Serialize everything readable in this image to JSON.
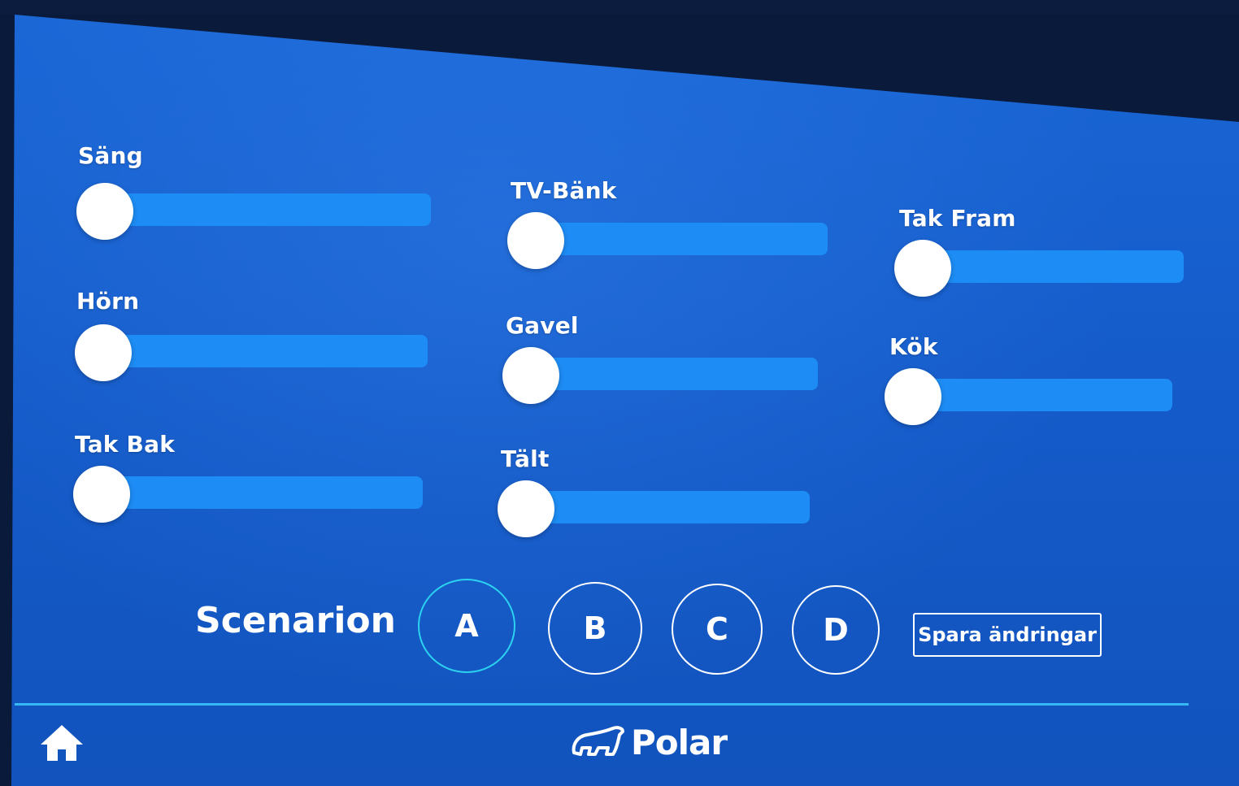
{
  "sliders": [
    {
      "label": "Säng",
      "value": 0
    },
    {
      "label": "Hörn",
      "value": 0
    },
    {
      "label": "Tak Bak",
      "value": 0
    },
    {
      "label": "TV-Bänk",
      "value": 0
    },
    {
      "label": "Gavel",
      "value": 0
    },
    {
      "label": "Tält",
      "value": 0
    },
    {
      "label": "Tak Fram",
      "value": 0
    },
    {
      "label": "Kök",
      "value": 0
    }
  ],
  "scenarios": {
    "label": "Scenarion",
    "buttons": [
      "A",
      "B",
      "C",
      "D"
    ],
    "active": "A",
    "save_label": "Spara ändringar"
  },
  "footer": {
    "logo_text": "Polar",
    "home_icon": "home-icon",
    "divider_color": "#37b8f2"
  },
  "colors": {
    "background": "#145ac8",
    "track": "#1d8cf4",
    "knob": "#ffffff",
    "active_ring": "#2bd1ef"
  }
}
